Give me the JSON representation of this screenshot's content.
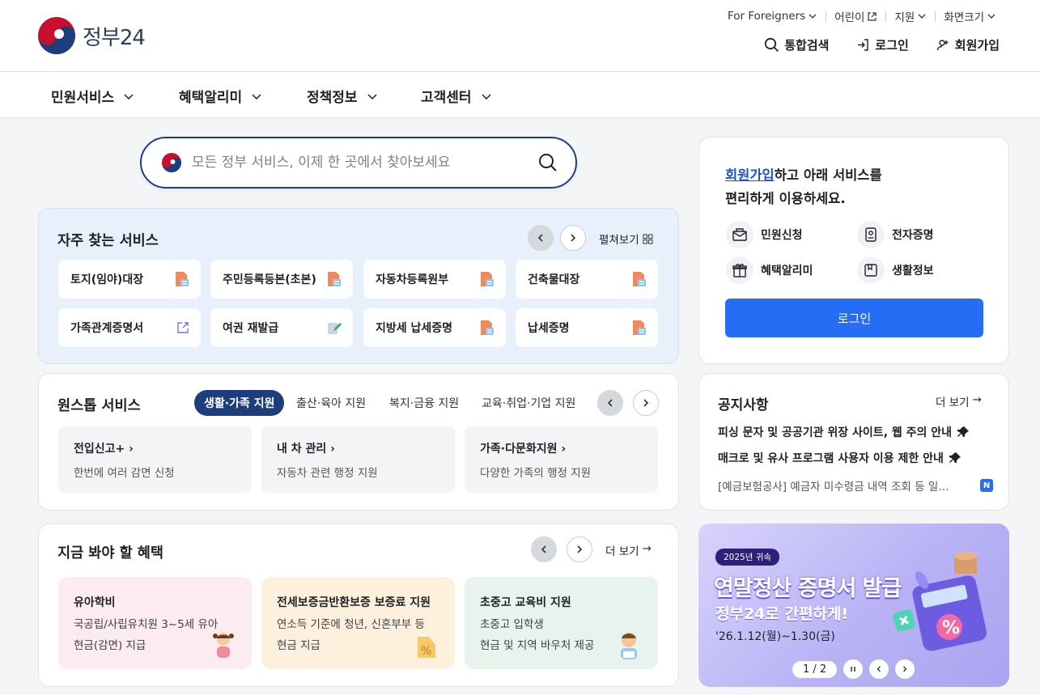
{
  "header": {
    "logo_text": "정부24",
    "utility": {
      "foreigners": "For Foreigners",
      "kids": "어린이",
      "region": "지원",
      "font_size": "화면크기"
    },
    "actions": {
      "search": "통합검색",
      "login": "로그인",
      "signup": "회원가입"
    }
  },
  "gnb": [
    "민원서비스",
    "혜택알리미",
    "정책정보",
    "고객센터"
  ],
  "search": {
    "placeholder": "모든 정부 서비스, 이제 한 곳에서 찾아보세요"
  },
  "frequent": {
    "title": "자주 찾는 서비스",
    "expand": "펼쳐보기",
    "items": [
      {
        "label": "토지(임야)대장",
        "icon": "document-icon"
      },
      {
        "label": "주민등록등본(초본)",
        "icon": "document-icon"
      },
      {
        "label": "자동차등록원부",
        "icon": "document-icon"
      },
      {
        "label": "건축물대장",
        "icon": "document-icon"
      },
      {
        "label": "가족관계증명서",
        "icon": "external-link-icon"
      },
      {
        "label": "여권 재발급",
        "icon": "pencil-icon"
      },
      {
        "label": "지방세 납세증명",
        "icon": "document-icon"
      },
      {
        "label": "납세증명",
        "icon": "document-icon"
      }
    ]
  },
  "onestop": {
    "title": "원스톱 서비스",
    "tabs": [
      "생활·가족 지원",
      "출산·육아 지원",
      "복지·금융 지원",
      "교육·취업·기업 지원"
    ],
    "items": [
      {
        "title": "전입신고+",
        "desc": "한번에 여러 감면 신청"
      },
      {
        "title": "내 차 관리",
        "desc": "자동차 관련 행정 지원"
      },
      {
        "title": "가족·다문화지원",
        "desc": "다양한 가족의 행정 지원"
      }
    ]
  },
  "benefits": {
    "title": "지금 봐야 할 혜택",
    "more": "더 보기",
    "items": [
      {
        "title": "유아학비",
        "line1": "국공립/사립유치원 3~5세 유아",
        "line2": "현금(감면) 지급",
        "bg": "#fcecef"
      },
      {
        "title": "전세보증금반환보증 보증료 지원",
        "line1": "연소득 기준에 청년, 신혼부부 등",
        "line2": "현금 지급",
        "bg": "#fdf1de"
      },
      {
        "title": "초중고 교육비 지원",
        "line1": "초중고 입학생",
        "line2": "현금 및 지역 바우처 제공",
        "bg": "#e7f3ec"
      }
    ]
  },
  "login_card": {
    "signup_link": "회원가입",
    "msg_rest": "하고 아래 서비스를",
    "msg_line2": "편리하게 이용하세요.",
    "services": [
      "민원신청",
      "전자증명",
      "혜택알리미",
      "생활정보"
    ],
    "button": "로그인"
  },
  "notice": {
    "title": "공지사항",
    "more": "더 보기",
    "items": [
      {
        "text": "피싱 문자 및 공공기관 위장 사이트, 웹 주의 안내",
        "pinned": true
      },
      {
        "text": "매크로 및 유사 프로그램 사용자 이용 제한 안내",
        "pinned": true
      },
      {
        "text": "[예금보험공사] 예금자 미수령금 내역 조회 등 일…",
        "badge": "N"
      }
    ]
  },
  "banner": {
    "tag": "2025년 귀속",
    "title": "연말정산 증명서 발급",
    "subtitle": "정부24로 간편하게!",
    "period": "'26.1.12(월)~1.30(금)",
    "pager": "1 / 2"
  },
  "colors": {
    "brand_navy": "#1c3e7a",
    "primary_blue": "#256ef4",
    "link_blue": "#1a56c9"
  }
}
